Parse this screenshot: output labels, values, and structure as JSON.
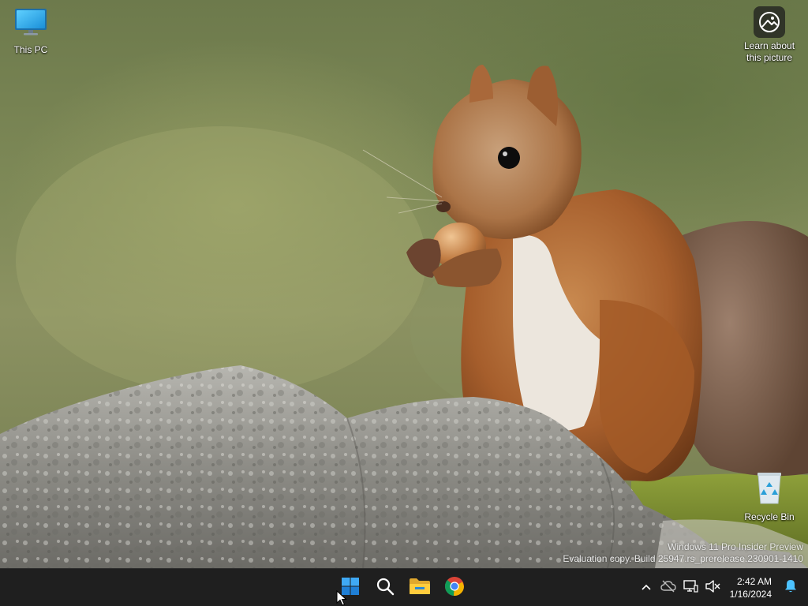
{
  "desktop": {
    "icons": [
      {
        "label": "This PC",
        "icon": "computer-monitor-icon"
      },
      {
        "label": "Learn about\nthis picture",
        "icon": "learn-picture-icon"
      },
      {
        "label": "Recycle Bin",
        "icon": "recycle-bin-icon"
      }
    ],
    "watermark": {
      "line1": "Windows 11 Pro Insider Preview",
      "line2": "Evaluation copy. Build 25947.rs_prerelease.230901-1410"
    }
  },
  "taskbar": {
    "pinned": [
      {
        "name": "Start",
        "icon": "windows-start-icon"
      },
      {
        "name": "Search",
        "icon": "search-icon"
      },
      {
        "name": "File Explorer",
        "icon": "folder-icon"
      },
      {
        "name": "Google Chrome",
        "icon": "chrome-icon"
      }
    ],
    "tray": {
      "overflow_icon": "chevron-up-icon",
      "icons": [
        "cloud-offline-icon",
        "network-icon",
        "volume-muted-icon"
      ],
      "time": "2:42 AM",
      "date": "1/16/2024",
      "notification_icon": "bell-icon"
    }
  },
  "colors": {
    "taskbar_bg": "#1f1f1f",
    "accent": "#0078d4",
    "text": "#ffffff"
  }
}
